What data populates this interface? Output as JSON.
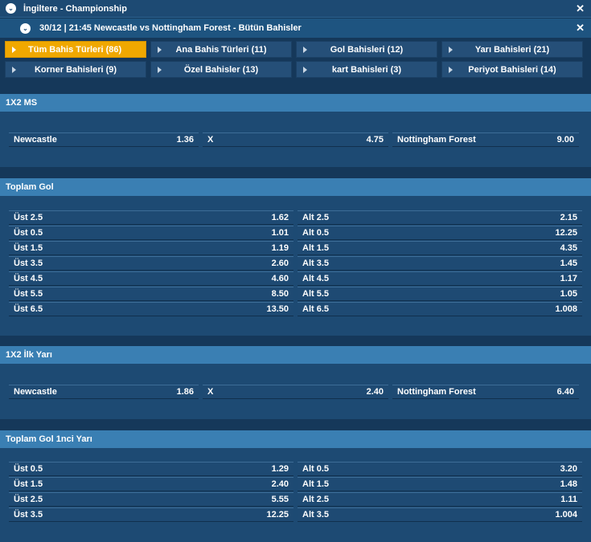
{
  "league_bar": {
    "title": "İngiltere - Championship",
    "close": "✕",
    "chevron": "⌄"
  },
  "match_bar": {
    "title": "30/12 | 21:45 Newcastle vs Nottingham Forest - Bütün Bahisler",
    "close": "✕",
    "chevron": "⌄"
  },
  "tabs": [
    {
      "label": "Tüm Bahis Türleri (86)"
    },
    {
      "label": "Ana Bahis Türleri (11)"
    },
    {
      "label": "Gol Bahisleri (12)"
    },
    {
      "label": "Yarı Bahisleri (21)"
    },
    {
      "label": "Korner Bahisleri (9)"
    },
    {
      "label": "Özel Bahisler (13)"
    },
    {
      "label": "kart Bahisleri (3)"
    },
    {
      "label": "Periyot Bahisleri (14)"
    }
  ],
  "sections": [
    {
      "title": "1X2 MS",
      "rows": [
        [
          {
            "name": "Newcastle",
            "odd": "1.36"
          },
          {
            "name": "X",
            "odd": "4.75"
          },
          {
            "name": "Nottingham Forest",
            "odd": "9.00"
          }
        ]
      ]
    },
    {
      "title": "Toplam Gol",
      "rows": [
        [
          {
            "name": "Üst 2.5",
            "odd": "1.62"
          },
          {
            "name": "Alt 2.5",
            "odd": "2.15"
          }
        ],
        [
          {
            "name": "Üst 0.5",
            "odd": "1.01"
          },
          {
            "name": "Alt 0.5",
            "odd": "12.25"
          }
        ],
        [
          {
            "name": "Üst 1.5",
            "odd": "1.19"
          },
          {
            "name": "Alt 1.5",
            "odd": "4.35"
          }
        ],
        [
          {
            "name": "Üst 3.5",
            "odd": "2.60"
          },
          {
            "name": "Alt 3.5",
            "odd": "1.45"
          }
        ],
        [
          {
            "name": "Üst 4.5",
            "odd": "4.60"
          },
          {
            "name": "Alt 4.5",
            "odd": "1.17"
          }
        ],
        [
          {
            "name": "Üst 5.5",
            "odd": "8.50"
          },
          {
            "name": "Alt 5.5",
            "odd": "1.05"
          }
        ],
        [
          {
            "name": "Üst 6.5",
            "odd": "13.50"
          },
          {
            "name": "Alt 6.5",
            "odd": "1.008"
          }
        ]
      ]
    },
    {
      "title": "1X2 İlk Yarı",
      "rows": [
        [
          {
            "name": "Newcastle",
            "odd": "1.86"
          },
          {
            "name": "X",
            "odd": "2.40"
          },
          {
            "name": "Nottingham Forest",
            "odd": "6.40"
          }
        ]
      ]
    },
    {
      "title": "Toplam Gol 1nci Yarı",
      "rows": [
        [
          {
            "name": "Üst 0.5",
            "odd": "1.29"
          },
          {
            "name": "Alt 0.5",
            "odd": "3.20"
          }
        ],
        [
          {
            "name": "Üst 1.5",
            "odd": "2.40"
          },
          {
            "name": "Alt 1.5",
            "odd": "1.48"
          }
        ],
        [
          {
            "name": "Üst 2.5",
            "odd": "5.55"
          },
          {
            "name": "Alt 2.5",
            "odd": "1.11"
          }
        ],
        [
          {
            "name": "Üst 3.5",
            "odd": "12.25"
          },
          {
            "name": "Alt 3.5",
            "odd": "1.004"
          }
        ]
      ]
    }
  ]
}
